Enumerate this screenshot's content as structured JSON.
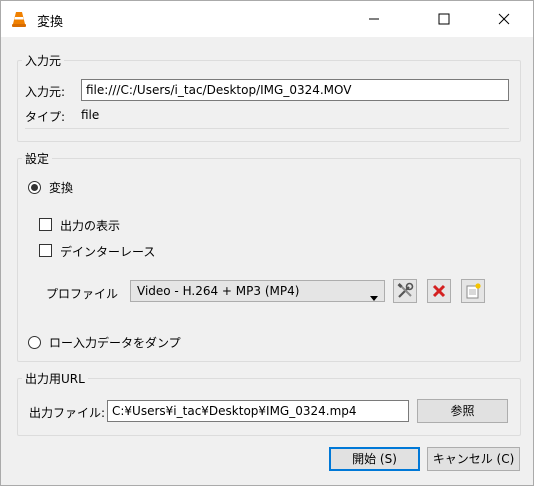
{
  "window": {
    "title": "変換"
  },
  "input_section": {
    "legend": "入力元",
    "source_label": "入力元:",
    "source_value": "file:///C:/Users/i_tac/Desktop/IMG_0324.MOV",
    "type_label": "タイプ:",
    "type_value": "file"
  },
  "settings": {
    "legend": "設定",
    "convert_label": "変換",
    "show_output_label": "出力の表示",
    "deinterlace_label": "デインターレース",
    "profile_label": "プロファイル",
    "profile_selected": "Video - H.264 + MP3 (MP4)",
    "dump_raw_label": "ロー入力データをダンプ"
  },
  "output": {
    "legend": "出力用URL",
    "file_label": "出力ファイル:",
    "file_value": "C:¥Users¥i_tac¥Desktop¥IMG_0324.mp4",
    "browse_label": "参照"
  },
  "buttons": {
    "start_label": "開始 (S)",
    "cancel_label": "キャンセル (C)"
  },
  "colors": {
    "accent": "#0078d7",
    "delete_red": "#d42020",
    "vlc_orange": "#f08000"
  },
  "icons": {
    "app": "vlc-cone-icon",
    "edit_profile": "tools-icon",
    "delete_profile": "red-x-icon",
    "new_profile": "new-document-icon"
  }
}
